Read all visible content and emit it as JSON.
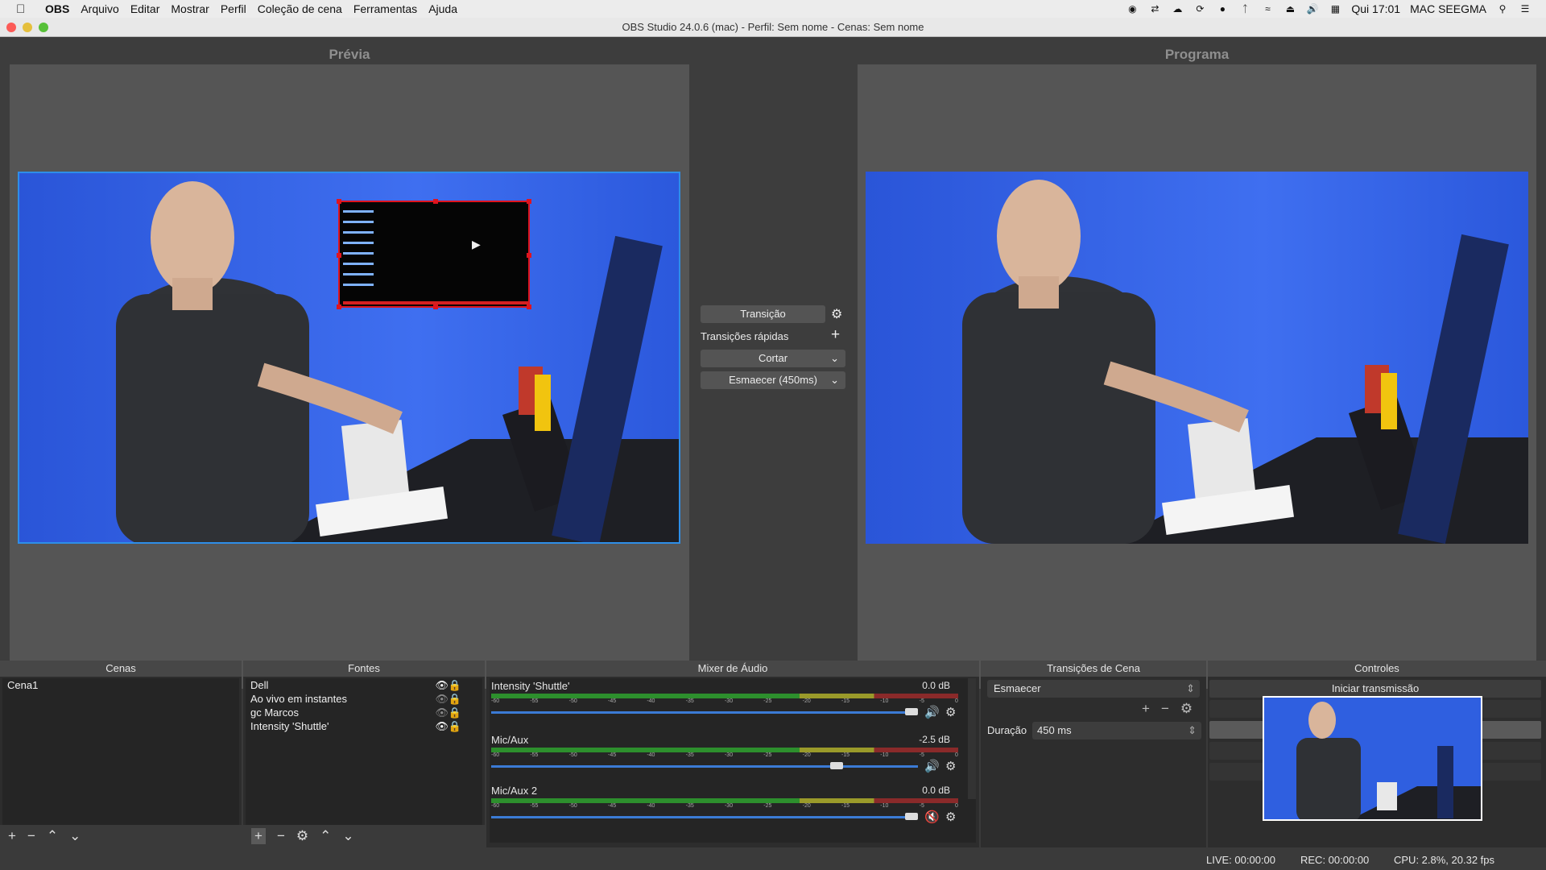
{
  "menubar": {
    "app": "OBS",
    "items": [
      "Arquivo",
      "Editar",
      "Mostrar",
      "Perfil",
      "Coleção de cena",
      "Ferramentas",
      "Ajuda"
    ],
    "clock": "Qui 17:01",
    "user": "MAC SEEGMA"
  },
  "window": {
    "title": "OBS Studio 24.0.6 (mac) - Perfil: Sem nome - Cenas: Sem nome"
  },
  "preview": {
    "label": "Prévia"
  },
  "program": {
    "label": "Programa"
  },
  "transition_panel": {
    "transition_button": "Transição",
    "quick_transitions_label": "Transições rápidas",
    "cut_label": "Cortar",
    "fade_label": "Esmaecer (450ms)"
  },
  "scenes": {
    "title": "Cenas",
    "items": [
      "Cena1"
    ]
  },
  "sources": {
    "title": "Fontes",
    "items": [
      "Dell",
      "Ao vivo em instantes",
      "gc Marcos",
      "Intensity 'Shuttle'"
    ]
  },
  "mixer": {
    "title": "Mixer de Áudio",
    "channels": [
      {
        "name": "Intensity 'Shuttle'",
        "db": "0.0 dB",
        "volume": 1.0,
        "muted": false
      },
      {
        "name": "Mic/Aux",
        "db": "-2.5 dB",
        "volume": 0.82,
        "muted": false
      },
      {
        "name": "Mic/Aux 2",
        "db": "0.0 dB",
        "volume": 1.0,
        "muted": true
      }
    ],
    "ticks": [
      "-60",
      "-55",
      "-50",
      "-45",
      "-40",
      "-35",
      "-30",
      "-25",
      "-20",
      "-15",
      "-10",
      "-5",
      "0"
    ]
  },
  "scene_transitions": {
    "title": "Transições de Cena",
    "selected": "Esmaecer",
    "duration_label": "Duração",
    "duration_value": "450 ms"
  },
  "controls": {
    "title": "Controles",
    "start_stream": "Iniciar transmissão"
  },
  "status": {
    "live": "LIVE: 00:00:00",
    "rec": "REC: 00:00:00",
    "cpu": "CPU: 2.8%, 20.32 fps"
  },
  "colors": {
    "accent": "#3b7bd5",
    "selection": "#e0141e",
    "backdrop": "#2f5fe0"
  }
}
